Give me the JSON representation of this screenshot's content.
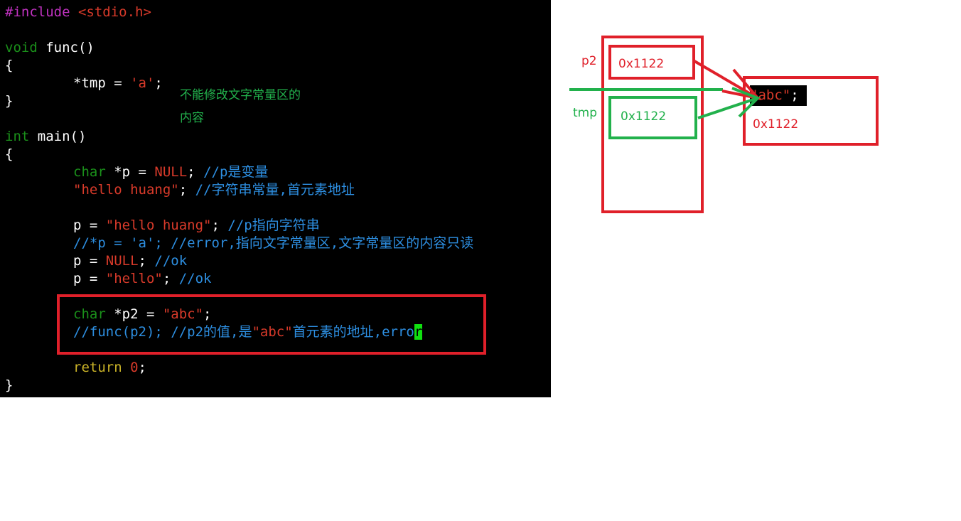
{
  "code": {
    "include_directive": "#include",
    "include_header": " <stdio.h>",
    "void_kw": "void",
    "func_sig": " func()",
    "brace_open": "{",
    "brace_close": "}",
    "tmp_lhs": "*tmp = ",
    "tmp_char": "'a'",
    "semi": ";",
    "int_kw": "int",
    "main_sig": " main()",
    "char_kw": "char",
    "p_decl": " *p = ",
    "null_val": "NULL",
    "semi_sp": "; ",
    "comment_p_var": "//p是变量",
    "hello_huang": "\"hello huang\"",
    "comment_str_const": "//字符串常量,首元素地址",
    "p_assign": "p = ",
    "comment_p_points": "//p指向字符串",
    "comment_error_line": "//*p = 'a'; //error,指向文字常量区,文字常量区的内容只读",
    "comment_ok": "//ok",
    "hello": "\"hello\"",
    "p2_decl": " *p2 = ",
    "abc": "\"abc\"",
    "comment_func_a": "//func(p2); //p2的值,是",
    "comment_func_b": "首元素的地址,erro",
    "cursor_char": "r",
    "return_kw": "return",
    "zero": "0",
    "semi_only": ";"
  },
  "annotation": {
    "line1": "不能修改文字常量区的",
    "line2": "内容"
  },
  "diagram": {
    "p2_label": "p2",
    "tmp_label": "tmp",
    "p2_value": "0x1122",
    "tmp_value": "0x1122",
    "abc_text": "\"abc\"",
    "abc_semi": ";",
    "abc_address": "0x1122"
  },
  "colors": {
    "red": "#e0202a",
    "green": "#22b14c",
    "editor_bg": "#000000"
  }
}
